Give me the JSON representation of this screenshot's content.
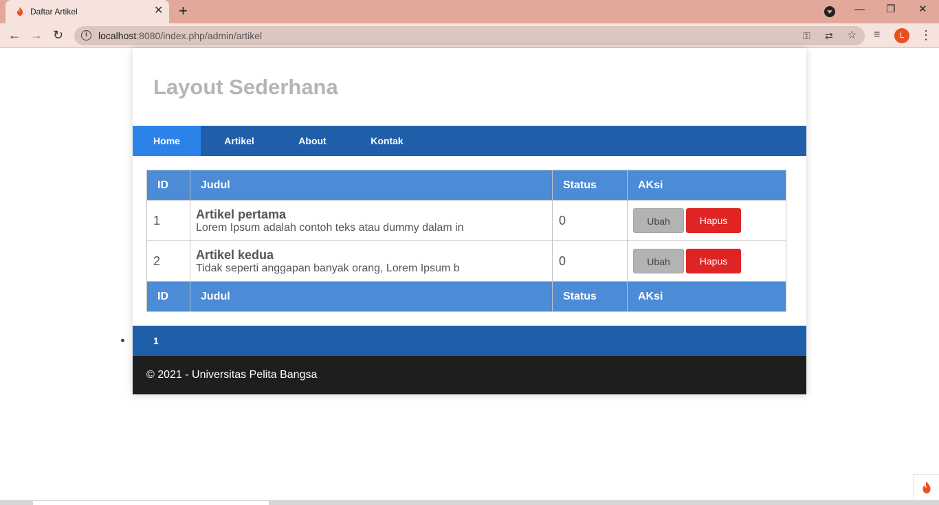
{
  "browser": {
    "tab_title": "Daftar Artikel",
    "tab_close": "✕",
    "new_tab": "+",
    "url_host": "localhost",
    "url_rest": ":8080/index.php/admin/artikel",
    "profile_initial": "L",
    "minimize": "—",
    "maximize": "❐",
    "close": "✕",
    "back": "←",
    "forward": "→",
    "reload": "↻",
    "info": "i",
    "key": "⚿",
    "translate": "⇄",
    "star": "☆",
    "queue": "≡",
    "menu": "⋮"
  },
  "page": {
    "site_title": "Layout Sederhana",
    "nav": [
      {
        "label": "Home",
        "active": true
      },
      {
        "label": "Artikel"
      },
      {
        "label": "About"
      },
      {
        "label": "Kontak"
      }
    ],
    "table": {
      "headers": [
        "ID",
        "Judul",
        "Status",
        "AKsi"
      ],
      "rows": [
        {
          "id": "1",
          "title": "Artikel pertama",
          "excerpt": "Lorem Ipsum adalah contoh teks atau dummy dalam in",
          "status": "0",
          "edit": "Ubah",
          "delete": "Hapus"
        },
        {
          "id": "2",
          "title": "Artikel kedua",
          "excerpt": "Tidak seperti anggapan banyak orang, Lorem Ipsum b",
          "status": "0",
          "edit": "Ubah",
          "delete": "Hapus"
        }
      ]
    },
    "pagination": {
      "current": "1"
    },
    "footer": "© 2021 - Universitas Pelita Bangsa"
  },
  "colors": {
    "tabbar": "#e2a99a",
    "navbar": "#1f5faa",
    "nav_active": "#2b83ea",
    "table_header": "#4c8bd5",
    "delete_button": "#e02323",
    "footer": "#1e1e1e"
  }
}
